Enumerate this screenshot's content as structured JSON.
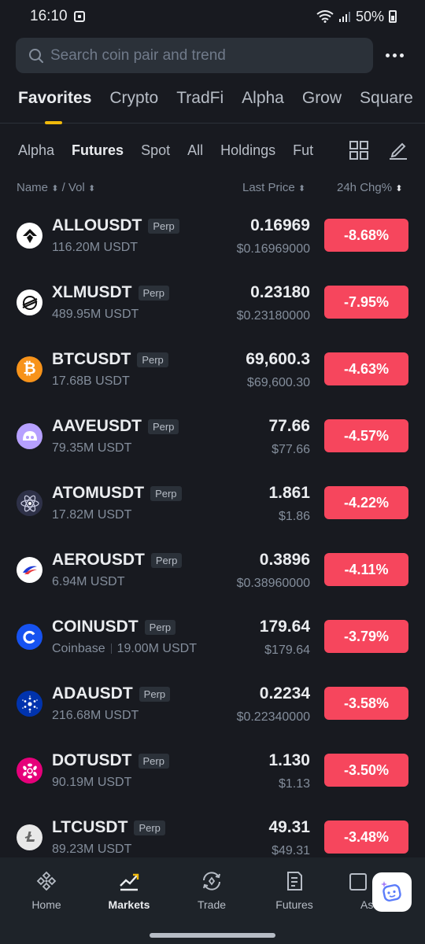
{
  "status": {
    "time": "16:10",
    "battery": "50%"
  },
  "search": {
    "placeholder": "Search coin pair and trend"
  },
  "main_tabs": [
    "Favorites",
    "Crypto",
    "TradFi",
    "Alpha",
    "Grow",
    "Square"
  ],
  "sub_tabs": [
    "Alpha",
    "Futures",
    "Spot",
    "All",
    "Holdings",
    "Fut"
  ],
  "columns": {
    "name": "Name",
    "vol": "/ Vol",
    "price": "Last Price",
    "change": "24h Chg%"
  },
  "colors": {
    "accent": "#f0b90b",
    "negative": "#f6465d",
    "background": "#181a20"
  },
  "rows": [
    {
      "symbol": "ALLOUSDT",
      "tag": "Perp",
      "vol": "116.20M USDT",
      "price": "0.16969",
      "price_usd": "$0.16969000",
      "change": "-8.68%",
      "icon": "allo-icon"
    },
    {
      "symbol": "XLMUSDT",
      "tag": "Perp",
      "vol": "489.95M USDT",
      "price": "0.23180",
      "price_usd": "$0.23180000",
      "change": "-7.95%",
      "icon": "xlm-icon"
    },
    {
      "symbol": "BTCUSDT",
      "tag": "Perp",
      "vol": "17.68B USDT",
      "price": "69,600.3",
      "price_usd": "$69,600.30",
      "change": "-4.63%",
      "icon": "btc-icon"
    },
    {
      "symbol": "AAVEUSDT",
      "tag": "Perp",
      "vol": "79.35M USDT",
      "price": "77.66",
      "price_usd": "$77.66",
      "change": "-4.57%",
      "icon": "aave-icon"
    },
    {
      "symbol": "ATOMUSDT",
      "tag": "Perp",
      "vol": "17.82M USDT",
      "price": "1.861",
      "price_usd": "$1.86",
      "change": "-4.22%",
      "icon": "atom-icon"
    },
    {
      "symbol": "AEROUSDT",
      "tag": "Perp",
      "vol": "6.94M USDT",
      "price": "0.3896",
      "price_usd": "$0.38960000",
      "change": "-4.11%",
      "icon": "aero-icon"
    },
    {
      "symbol": "COINUSDT",
      "tag": "Perp",
      "vol": "19.00M USDT",
      "sub": "Coinbase",
      "price": "179.64",
      "price_usd": "$179.64",
      "change": "-3.79%",
      "icon": "coinbase-icon"
    },
    {
      "symbol": "ADAUSDT",
      "tag": "Perp",
      "vol": "216.68M USDT",
      "price": "0.2234",
      "price_usd": "$0.22340000",
      "change": "-3.58%",
      "icon": "ada-icon"
    },
    {
      "symbol": "DOTUSDT",
      "tag": "Perp",
      "vol": "90.19M USDT",
      "price": "1.130",
      "price_usd": "$1.13",
      "change": "-3.50%",
      "icon": "dot-icon"
    },
    {
      "symbol": "LTCUSDT",
      "tag": "Perp",
      "vol": "89.23M USDT",
      "price": "49.31",
      "price_usd": "$49.31",
      "change": "-3.48%",
      "icon": "ltc-icon"
    }
  ],
  "nav": [
    "Home",
    "Markets",
    "Trade",
    "Futures",
    "As"
  ]
}
